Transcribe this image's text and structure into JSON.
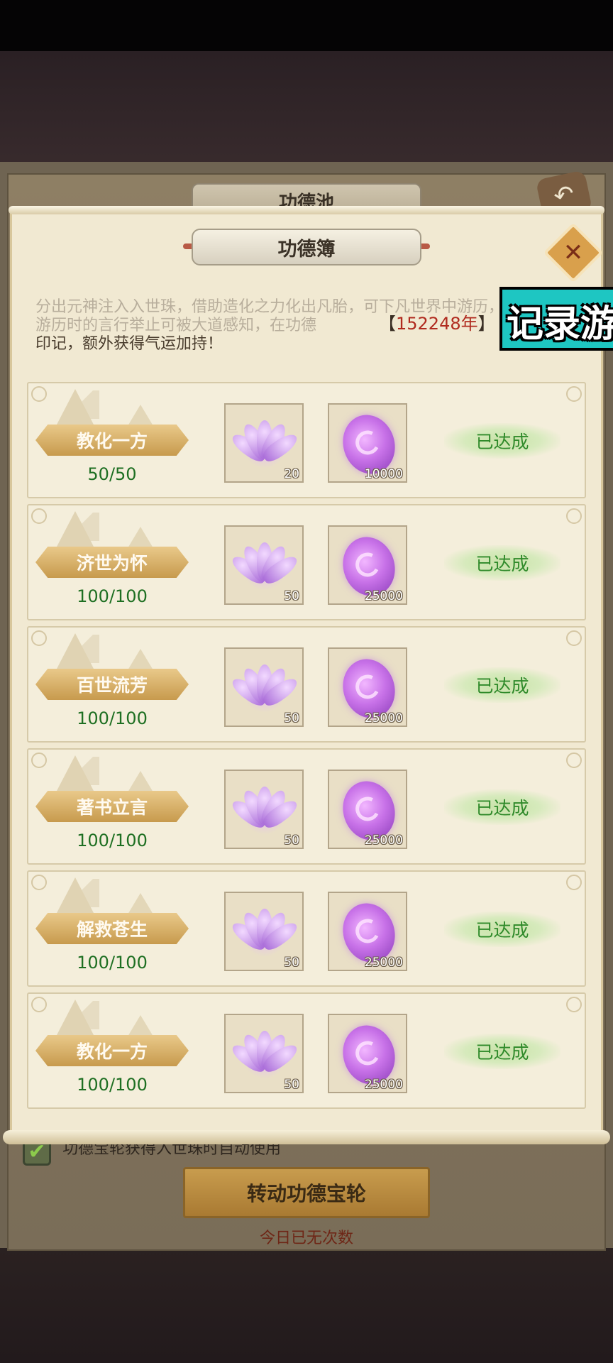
{
  "underlying_window": {
    "title": "功德池",
    "auto_use_label": "功德宝轮获得入世珠时自动使用",
    "spin_button_label": "转动功德宝轮",
    "spin_status": "今日已无次数"
  },
  "modal": {
    "title": "功德簿",
    "description_faded": "分出元神注入入世珠，借助造化之力化出凡胎，可下凡世界中游历，游历时的言行举止可被大道感知，在功德",
    "description_tail": "印记，额外获得气运加持！",
    "year_value": "152248年",
    "year_bracket_open": "【",
    "year_bracket_close": "】"
  },
  "watermark": {
    "text": "记录游"
  },
  "tasks": [
    {
      "name": "教化一方",
      "progress": "50/50",
      "reward1_qty": "20",
      "reward2_qty": "10000",
      "status": "已达成"
    },
    {
      "name": "济世为怀",
      "progress": "100/100",
      "reward1_qty": "50",
      "reward2_qty": "25000",
      "status": "已达成"
    },
    {
      "name": "百世流芳",
      "progress": "100/100",
      "reward1_qty": "50",
      "reward2_qty": "25000",
      "status": "已达成"
    },
    {
      "name": "著书立言",
      "progress": "100/100",
      "reward1_qty": "50",
      "reward2_qty": "25000",
      "status": "已达成"
    },
    {
      "name": "解救苍生",
      "progress": "100/100",
      "reward1_qty": "50",
      "reward2_qty": "25000",
      "status": "已达成"
    },
    {
      "name": "教化一方",
      "progress": "100/100",
      "reward1_qty": "50",
      "reward2_qty": "25000",
      "status": "已达成"
    }
  ],
  "icons": {
    "reward1": "purple-lotus-icon",
    "reward2": "purple-jade-token-icon",
    "close": "close-icon",
    "back": "back-arrow-icon",
    "checkbox": "checkmark-icon"
  },
  "colors": {
    "status_green": "#2f8a2a",
    "progress_green": "#1e6f22",
    "year_red": "#b02a1e",
    "watermark_cyan": "#1ec6c2",
    "task_gold": "#c79a4d"
  }
}
